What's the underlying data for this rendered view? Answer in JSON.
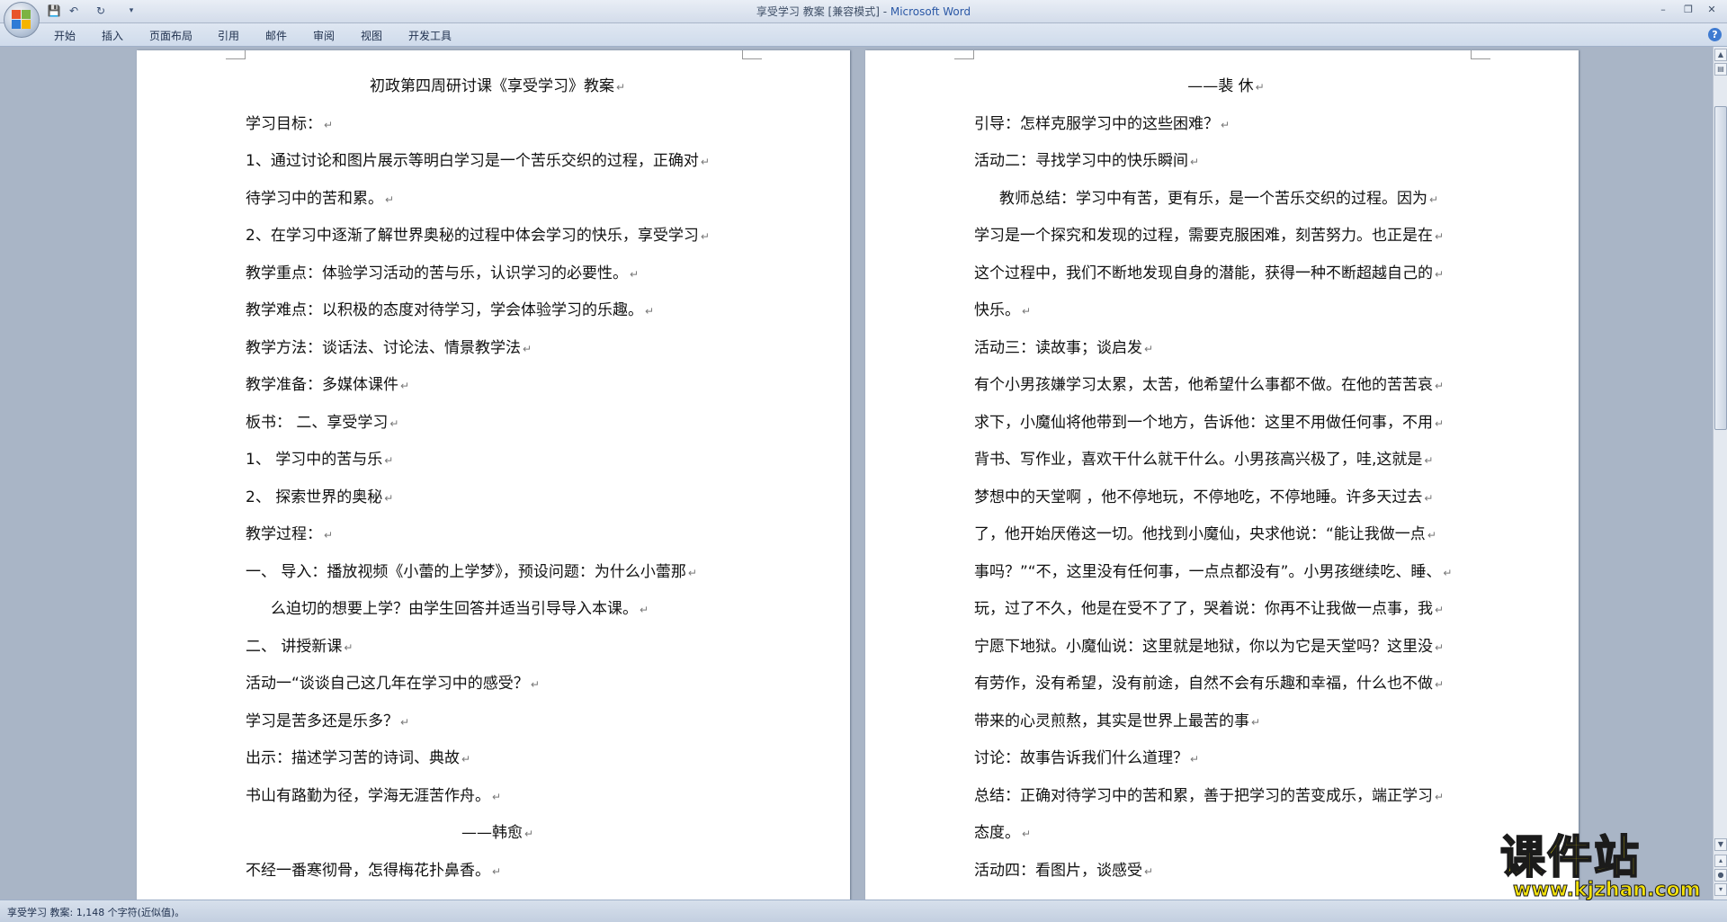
{
  "window": {
    "doc_name": "享受学习 教案",
    "mode": " [兼容模式] - ",
    "app_name": "Microsoft Word",
    "min": "–",
    "max": "❐",
    "close": "✕"
  },
  "tabs": [
    "开始",
    "插入",
    "页面布局",
    "引用",
    "邮件",
    "审阅",
    "视图",
    "开发工具"
  ],
  "help": "?",
  "left_page": [
    {
      "text": "初政第四周研讨课《享受学习》教案",
      "align": "center"
    },
    {
      "text": "学习目标：",
      "align": "left"
    },
    {
      "text": "1、通过讨论和图片展示等明白学习是一个苦乐交织的过程，正确对",
      "align": "left"
    },
    {
      "text": "待学习中的苦和累。",
      "align": "left"
    },
    {
      "text": "2、在学习中逐渐了解世界奥秘的过程中体会学习的快乐，享受学习",
      "align": "left"
    },
    {
      "text": "教学重点：体验学习活动的苦与乐，认识学习的必要性。",
      "align": "left"
    },
    {
      "text": "教学难点：以积极的态度对待学习，学会体验学习的乐趣。",
      "align": "left"
    },
    {
      "text": "教学方法：谈话法、讨论法、情景教学法",
      "align": "left"
    },
    {
      "text": "教学准备：多媒体课件",
      "align": "left"
    },
    {
      "text": "板书：                      二、享受学习",
      "align": "left"
    },
    {
      "text": "1、    学习中的苦与乐",
      "align": "left"
    },
    {
      "text": "2、    探索世界的奥秘",
      "align": "left"
    },
    {
      "text": "教学过程：",
      "align": "left"
    },
    {
      "text": "一、    导入：播放视频《小蕾的上学梦》，预设问题：为什么小蕾那",
      "align": "left"
    },
    {
      "text": "么迫切的想要上学？由学生回答并适当引导导入本课。",
      "align": "indent"
    },
    {
      "text": "二、    讲授新课",
      "align": "left"
    },
    {
      "text": "活动一“谈谈自己这几年在学习中的感受？",
      "align": "left"
    },
    {
      "text": "学习是苦多还是乐多？",
      "align": "left"
    },
    {
      "text": "出示：描述学习苦的诗词、典故",
      "align": "left"
    },
    {
      "text": "书山有路勤为径，学海无涯苦作舟。",
      "align": "left"
    },
    {
      "text": "——韩愈",
      "align": "center"
    },
    {
      "text": "不经一番寒彻骨，怎得梅花扑鼻香。",
      "align": "left"
    }
  ],
  "right_page": [
    {
      "text": "——裴  休",
      "align": "center"
    },
    {
      "text": "引导：怎样克服学习中的这些困难？",
      "align": "left"
    },
    {
      "text": "活动二：寻找学习中的快乐瞬间",
      "align": "left"
    },
    {
      "text": "教师总结：学习中有苦，更有乐，是一个苦乐交织的过程。因为",
      "align": "indent"
    },
    {
      "text": "学习是一个探究和发现的过程，需要克服困难，刻苦努力。也正是在",
      "align": "left"
    },
    {
      "text": "这个过程中，我们不断地发现自身的潜能，获得一种不断超越自己的",
      "align": "left"
    },
    {
      "text": "快乐。",
      "align": "left"
    },
    {
      "text": "活动三：读故事；谈启发",
      "align": "left"
    },
    {
      "text": "有个小男孩嫌学习太累，太苦，他希望什么事都不做。在他的苦苦哀",
      "align": "left"
    },
    {
      "text": "求下，小魔仙将他带到一个地方，告诉他：这里不用做任何事，不用",
      "align": "left"
    },
    {
      "text": "背书、写作业，喜欢干什么就干什么。小男孩高兴极了，哇,这就是",
      "align": "left"
    },
    {
      "text": "梦想中的天堂啊 ，他不停地玩，不停地吃，不停地睡。许多天过去",
      "align": "left"
    },
    {
      "text": "了，他开始厌倦这一切。他找到小魔仙，央求他说：“能让我做一点",
      "align": "left"
    },
    {
      "text": "事吗？”“不，这里没有任何事，一点点都没有”。小男孩继续吃、睡、",
      "align": "left"
    },
    {
      "text": "玩，过了不久，他是在受不了了，哭着说：你再不让我做一点事，我",
      "align": "left"
    },
    {
      "text": "宁愿下地狱。小魔仙说：这里就是地狱，你以为它是天堂吗？这里没",
      "align": "left"
    },
    {
      "text": "有劳作，没有希望，没有前途，自然不会有乐趣和幸福，什么也不做",
      "align": "left"
    },
    {
      "text": "带来的心灵煎熬，其实是世界上最苦的事",
      "align": "left"
    },
    {
      "text": "讨论：故事告诉我们什么道理？",
      "align": "left"
    },
    {
      "text": "总结：正确对待学习中的苦和累，善于把学习的苦变成乐，端正学习",
      "align": "left"
    },
    {
      "text": "态度。",
      "align": "left"
    },
    {
      "text": "活动四：看图片，谈感受",
      "align": "left"
    }
  ],
  "paragraph_mark": "↵",
  "status": "享受学习 教案: 1,148 个字符(近似值)。",
  "watermark": {
    "title": "课件站",
    "url": "www.kjzhan.com"
  }
}
